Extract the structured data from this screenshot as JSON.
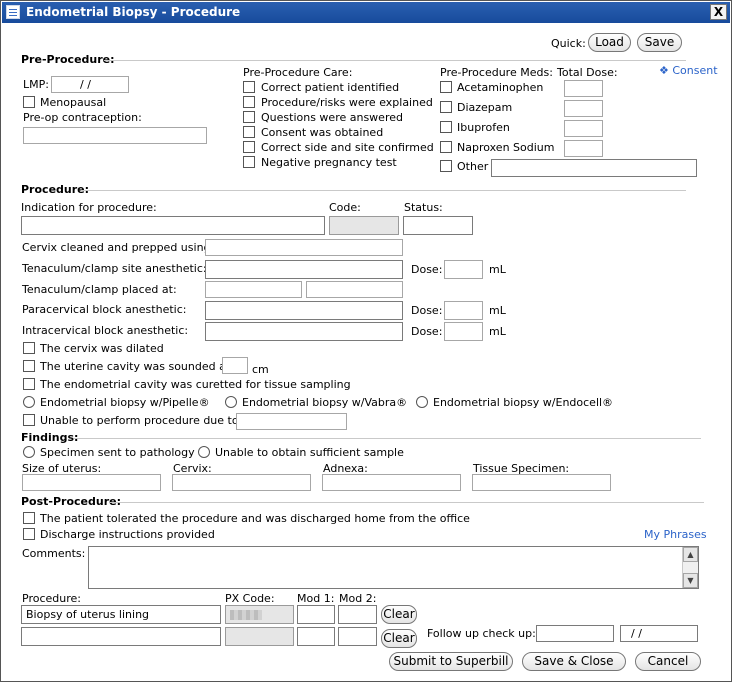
{
  "window": {
    "title": "Endometrial Biopsy - Procedure",
    "close_label": "X"
  },
  "quick": {
    "label": "Quick:",
    "load_label": "Load",
    "save_label": "Save"
  },
  "pre_procedure": {
    "section_label": "Pre-Procedure:",
    "lmp_label": "LMP:",
    "lmp_value": "/ /",
    "menopausal_label": "Menopausal",
    "contraception_label": "Pre-op contraception:",
    "care_label": "Pre-Procedure Care:",
    "care_items": [
      "Correct patient identified",
      "Procedure/risks were explained",
      "Questions were answered",
      "Consent was obtained",
      "Correct side and site confirmed",
      "Negative pregnancy test"
    ],
    "meds_label": "Pre-Procedure Meds:",
    "total_dose_label": "Total Dose:",
    "consent_link": "Consent",
    "meds": [
      "Acetaminophen",
      "Diazepam",
      "Ibuprofen",
      "Naproxen Sodium",
      "Other"
    ]
  },
  "procedure": {
    "section_label": "Procedure:",
    "indication_label": "Indication for procedure:",
    "code_label": "Code:",
    "status_label": "Status:",
    "cervix_label": "Cervix cleaned and prepped using:",
    "tenaculum_anesthetic_label": "Tenaculum/clamp site anesthetic:",
    "tenaculum_placed_label": "Tenaculum/clamp placed at:",
    "paracervical_label": "Paracervical block anesthetic:",
    "intracervical_label": "Intracervical block anesthetic:",
    "dose_label": "Dose:",
    "ml_label": "mL",
    "dilated_label": "The cervix was dilated",
    "sounded_label": "The uterine cavity was sounded at:",
    "cm_label": "cm",
    "curetted_label": "The endometrial cavity was curetted for tissue sampling",
    "biopsy_options": [
      "Endometrial biopsy w/Pipelle®",
      "Endometrial biopsy w/Vabra®",
      "Endometrial biopsy w/Endocell®"
    ],
    "unable_label": "Unable to perform procedure due to:"
  },
  "findings": {
    "section_label": "Findings:",
    "sent_label": "Specimen sent to pathology",
    "unable_sample_label": "Unable to obtain sufficient sample",
    "size_label": "Size of uterus:",
    "cervix_label": "Cervix:",
    "adnexa_label": "Adnexa:",
    "tissue_label": "Tissue Specimen:"
  },
  "post_procedure": {
    "section_label": "Post-Procedure:",
    "tolerated_label": "The patient tolerated the procedure and was discharged home from the office",
    "discharge_label": "Discharge instructions provided",
    "my_phrases_link": "My Phrases",
    "comments_label": "Comments:"
  },
  "billing": {
    "procedure_label": "Procedure:",
    "px_code_label": "PX Code:",
    "mod1_label": "Mod 1:",
    "mod2_label": "Mod 2:",
    "row1_procedure": "Biopsy of uterus lining",
    "clear_label": "Clear",
    "follow_up_label": "Follow up check up:",
    "follow_up_date": "/ /"
  },
  "footer": {
    "superbill_label": "Submit to Superbill",
    "save_close_label": "Save & Close",
    "cancel_label": "Cancel"
  },
  "colors": {
    "title_bar": "#174b9c",
    "link": "#2b63c9"
  }
}
